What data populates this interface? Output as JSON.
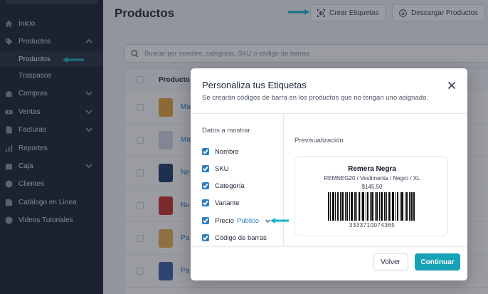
{
  "sidebar": {
    "items": [
      {
        "label": "Inicio",
        "icon": "home-icon"
      },
      {
        "label": "Productos",
        "icon": "tag-icon",
        "expanded": true
      },
      {
        "label": "Compras",
        "icon": "basket-icon"
      },
      {
        "label": "Ventas",
        "icon": "cash-icon"
      },
      {
        "label": "Facturas",
        "icon": "invoice-icon"
      },
      {
        "label": "Reportes",
        "icon": "chart-icon"
      },
      {
        "label": "Caja",
        "icon": "cashbox-icon"
      },
      {
        "label": "Clientes",
        "icon": "user-icon"
      },
      {
        "label": "Catálogo en Línea",
        "icon": "catalog-icon"
      },
      {
        "label": "Videos Tutoriales",
        "icon": "play-icon"
      }
    ],
    "sub_items": [
      {
        "label": "Productos",
        "active": true
      },
      {
        "label": "Traspasos",
        "active": false
      }
    ]
  },
  "header": {
    "title": "Productos",
    "create_labels_button": "Crear Etiquetas",
    "download_button": "Descargar Productos"
  },
  "search": {
    "placeholder": "Buscar por nombre, categoría, SKU o código de barras"
  },
  "table": {
    "columns": [
      "Producto"
    ],
    "rows": [
      {
        "name": "Ma",
        "thumb_color": "#e7a43a"
      },
      {
        "name": "Ma",
        "thumb_color": "#cfd8e6"
      },
      {
        "name": "Ne",
        "thumb_color": "#1f3a6b"
      },
      {
        "name": "Nu",
        "thumb_color": "#c9302c"
      },
      {
        "name": "Pa",
        "thumb_color": "#e8b04a"
      },
      {
        "name": "Pa",
        "thumb_color": "#3d5fa8"
      }
    ]
  },
  "modal": {
    "title": "Personaliza tus Etiquetas",
    "subtitle": "Se crearán códigos de barra en los productos que no tengan uno asignado.",
    "data_section_label": "Datos a mostrar",
    "options": [
      {
        "label": "Nombre",
        "checked": true
      },
      {
        "label": "SKU",
        "checked": true
      },
      {
        "label": "Categoría",
        "checked": true
      },
      {
        "label": "Variante",
        "checked": true
      },
      {
        "label": "Precio",
        "accent": "Público",
        "checked": true
      },
      {
        "label": "Código de barras",
        "checked": true
      }
    ],
    "preview_label": "Previsualización",
    "preview": {
      "name": "Remera Negra",
      "meta": "REMNEG20 / Vestimenta / Negro / XL",
      "price": "$145.50",
      "code": "3333710074365"
    },
    "back_button": "Volver",
    "continue_button": "Continuar"
  },
  "colors": {
    "sidebar_bg": "#1b2431",
    "accent": "#17a2b8",
    "checkbox": "#2a7fc5",
    "link": "#2a74c9"
  }
}
